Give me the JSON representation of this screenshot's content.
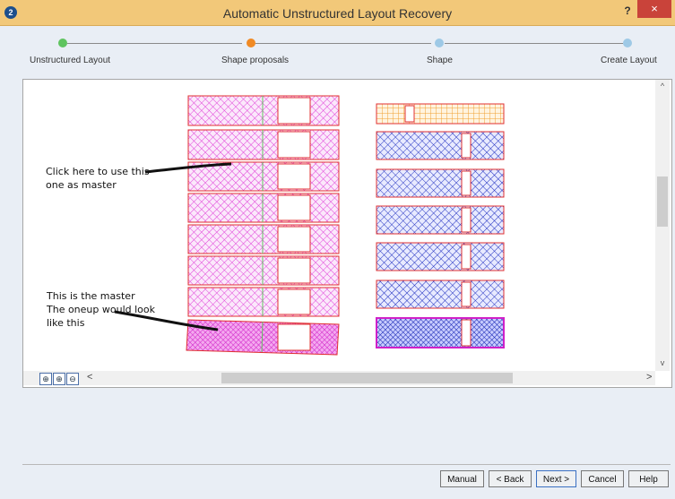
{
  "window": {
    "title": "Automatic Unstructured Layout Recovery",
    "help": "?",
    "close": "×"
  },
  "steps": [
    {
      "label": "Unstructured Layout",
      "state": "done",
      "color": "#5fc45f"
    },
    {
      "label": "Shape proposals",
      "state": "current",
      "color": "#f08a24"
    },
    {
      "label": "Shape",
      "state": "pending",
      "color": "#9ec9e6"
    },
    {
      "label": "Create Layout",
      "state": "pending",
      "color": "#9ec9e6"
    }
  ],
  "notes": {
    "master_hint": [
      "Click here to use this",
      "one as master"
    ],
    "master_label": [
      "This is the master",
      "The oneup would look",
      "like this"
    ]
  },
  "shapes": {
    "left_column_count": 8,
    "right_column_count": 7,
    "colors": {
      "outline": "#e03030",
      "magenta_fill": "#e040d8",
      "blue_fill": "#2030c0",
      "orange_fill": "#f0a030",
      "green_guide": "#60c060"
    }
  },
  "scroll": {
    "left_arrow": "<",
    "right_arrow": ">",
    "up_arrow": "^",
    "down_arrow": "v"
  },
  "zoom": {
    "fit": "⊕",
    "in": "⊕",
    "out": "⊖"
  },
  "buttons": {
    "manual": "Manual",
    "back": "< Back",
    "next": "Next >",
    "cancel": "Cancel",
    "help": "Help"
  }
}
